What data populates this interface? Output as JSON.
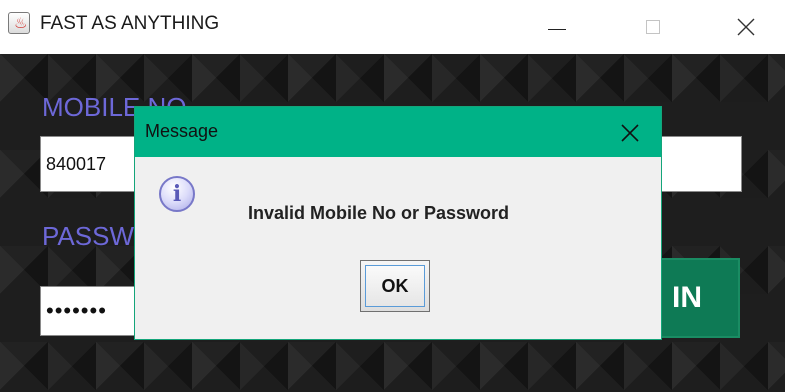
{
  "window": {
    "title": "FAST AS ANYTHING",
    "app_icon": "java-cup-icon"
  },
  "form": {
    "mobile_label": "MOBILE NO",
    "mobile_value": "840017",
    "password_label": "PASSWORD",
    "password_value": "•••••••",
    "login_label": "IN"
  },
  "dialog": {
    "title": "Message",
    "icon": "info-icon",
    "message": "Invalid Mobile No or Password",
    "ok_label": "OK"
  },
  "colors": {
    "dialog_titlebar": "#00b287",
    "label_color": "#6d68d8",
    "login_button": "#0e7a55"
  }
}
